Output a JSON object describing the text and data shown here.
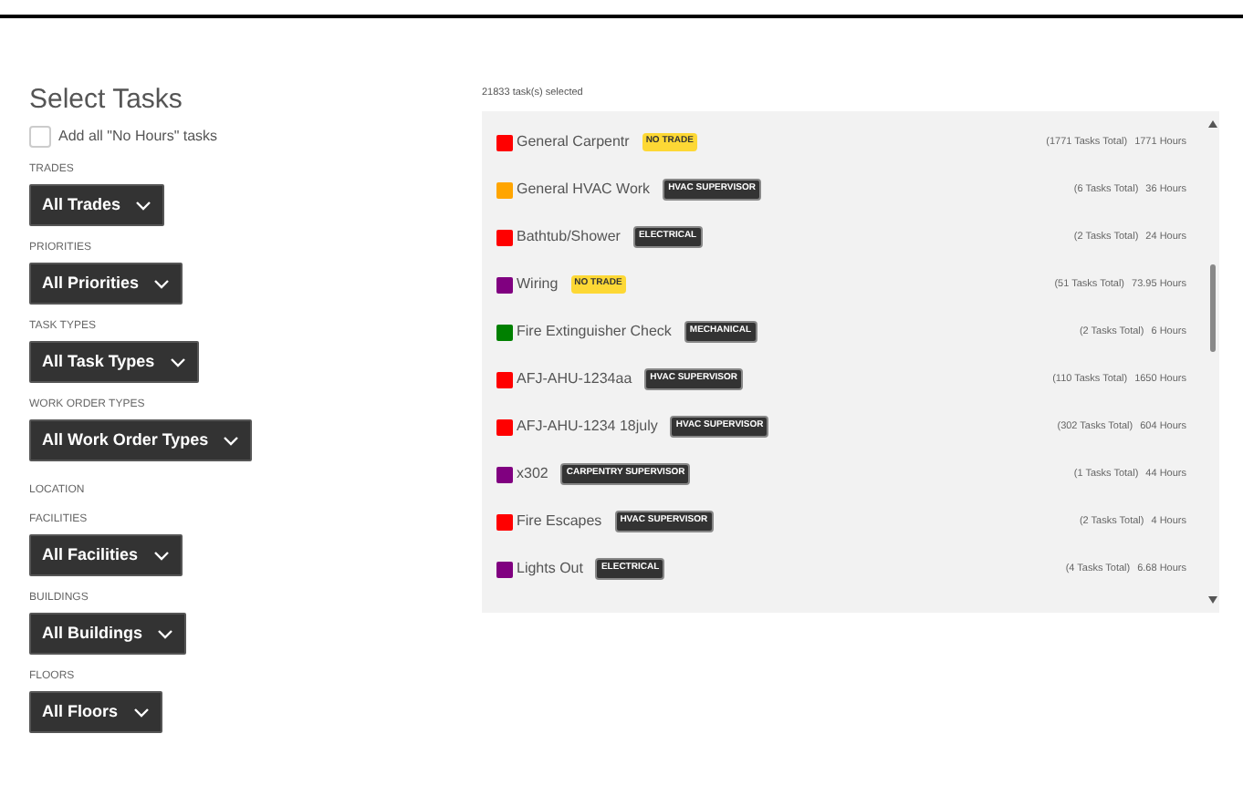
{
  "title": "Select Tasks",
  "no_hours_checkbox": {
    "label": "Add all \"No Hours\" tasks",
    "checked": false
  },
  "filters": [
    {
      "kind": "dropdown",
      "label": "TRADES",
      "value": "All Trades"
    },
    {
      "kind": "dropdown",
      "label": "PRIORITIES",
      "value": "All Priorities"
    },
    {
      "kind": "dropdown",
      "label": "TASK TYPES",
      "value": "All Task Types"
    },
    {
      "kind": "dropdown",
      "label": "WORK ORDER TYPES",
      "value": "All Work Order Types"
    },
    {
      "kind": "heading",
      "label": "LOCATION"
    },
    {
      "kind": "dropdown",
      "label": "FACILITIES",
      "value": "All Facilities"
    },
    {
      "kind": "dropdown",
      "label": "BUILDINGS",
      "value": "All Buildings"
    },
    {
      "kind": "dropdown",
      "label": "FLOORS",
      "value": "All Floors"
    }
  ],
  "selected_count": "21833 task(s) selected",
  "tasks": [
    {
      "name": "General Carpentr",
      "color": "#ff0000",
      "tag": {
        "label": "NO TRADE",
        "kind": "warning"
      },
      "total": "(1771 Tasks Total)",
      "hours": "1771 Hours"
    },
    {
      "name": "General HVAC Work",
      "color": "#ffa500",
      "tag": {
        "label": "HVAC SUPERVISOR",
        "kind": "dark"
      },
      "total": "(6 Tasks Total)",
      "hours": "36 Hours"
    },
    {
      "name": "Bathtub/Shower",
      "color": "#ff0000",
      "tag": {
        "label": "ELECTRICAL",
        "kind": "dark"
      },
      "total": "(2 Tasks Total)",
      "hours": "24 Hours"
    },
    {
      "name": "Wiring",
      "color": "#800080",
      "tag": {
        "label": "NO TRADE",
        "kind": "warning"
      },
      "total": "(51 Tasks Total)",
      "hours": "73.95 Hours"
    },
    {
      "name": "Fire Extinguisher Check",
      "color": "#008000",
      "tag": {
        "label": "MECHANICAL",
        "kind": "dark"
      },
      "total": "(2 Tasks Total)",
      "hours": "6 Hours"
    },
    {
      "name": "AFJ-AHU-1234aa",
      "color": "#ff0000",
      "tag": {
        "label": "HVAC SUPERVISOR",
        "kind": "dark"
      },
      "total": "(110 Tasks Total)",
      "hours": "1650 Hours"
    },
    {
      "name": "AFJ-AHU-1234 18july",
      "color": "#ff0000",
      "tag": {
        "label": "HVAC SUPERVISOR",
        "kind": "dark"
      },
      "total": "(302 Tasks Total)",
      "hours": "604 Hours"
    },
    {
      "name": "x302",
      "color": "#800080",
      "tag": {
        "label": "CARPENTRY SUPERVISOR",
        "kind": "dark"
      },
      "total": "(1 Tasks Total)",
      "hours": "44 Hours"
    },
    {
      "name": "Fire Escapes",
      "color": "#ff0000",
      "tag": {
        "label": "HVAC SUPERVISOR",
        "kind": "dark"
      },
      "total": "(2 Tasks Total)",
      "hours": "4 Hours"
    },
    {
      "name": "Lights Out",
      "color": "#800080",
      "tag": {
        "label": "ELECTRICAL",
        "kind": "dark"
      },
      "total": "(4 Tasks Total)",
      "hours": "6.68 Hours"
    }
  ]
}
